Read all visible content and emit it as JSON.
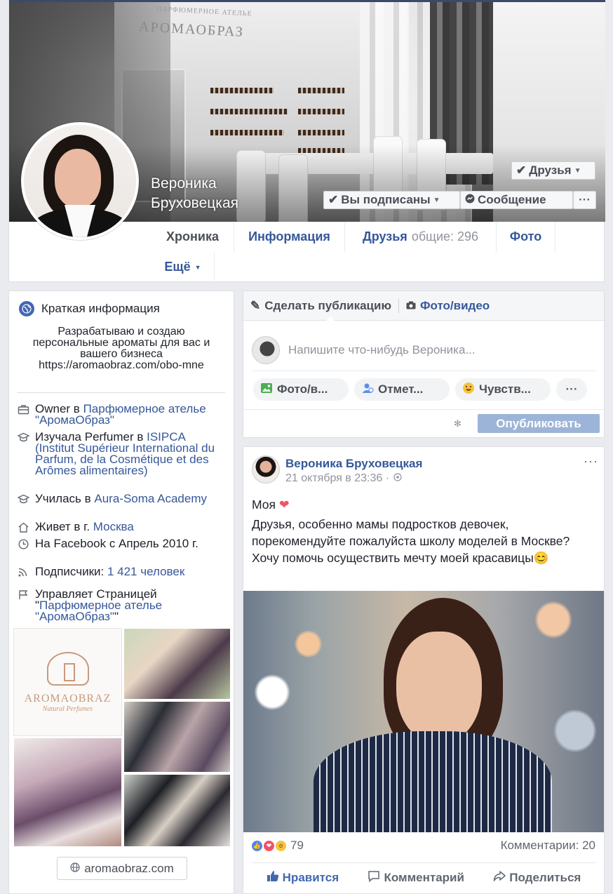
{
  "profile": {
    "name": "Вероника Бруховецкая",
    "cover_brand": "АРОМАОБРАЗ",
    "cover_brand_small": "ПАРФЮМЕРНОЕ АТЕЛЬЕ"
  },
  "buttons": {
    "friends": "Друзья",
    "subscribed": "Вы подписаны",
    "message": "Сообщение",
    "more": "···"
  },
  "tabs": {
    "timeline": "Хроника",
    "about": "Информация",
    "friends": "Друзья",
    "friends_mutual": "общие: 296",
    "photos": "Фото",
    "more": "Ещё"
  },
  "intro": {
    "title": "Краткая информация",
    "bio": "Разрабатываю и создаю персональные ароматы для вас и вашего бизнеса https://aromaobraz.com/obo-mne",
    "owner_prefix": "Owner в ",
    "owner_link": "Парфюмерное ателье \"АромаОбраз\"",
    "studied_prefix": "Изучала Perfumer в ",
    "studied_link": "ISIPCA (Institut Supérieur International du Parfum, de la Cosmétique et des Arômes alimentaires)",
    "studied2_prefix": "Училась в ",
    "studied2_link": "Aura-Soma Academy",
    "lives_prefix": "Живет в г. ",
    "lives_link": "Москва",
    "since": "На Facebook с Апрель 2010 г.",
    "followers_prefix": "Подписчики: ",
    "followers_link": "1 421 человек",
    "manages_prefix": "Управляет Страницей \"",
    "manages_link": "Парфюмерное ателье \"АромаОбраз\"",
    "manages_suffix": "\"",
    "logo_name": "AROMAOBRAZ",
    "logo_sub": "Natural Perfumes",
    "website": "aromaobraz.com"
  },
  "composer": {
    "tab_post": "Сделать публикацию",
    "tab_photo": "Фото/видео",
    "placeholder": "Напишите что-нибудь Вероника...",
    "pill_photo": "Фото/в...",
    "pill_tag": "Отмет...",
    "pill_feeling": "Чувств...",
    "pill_more": "···",
    "publish": "Опубликовать"
  },
  "post": {
    "author": "Вероника Бруховецкая",
    "time": "21 октября в 23:36 ·",
    "line1": "Моя",
    "body": "Друзья, особенно мамы подростков девочек, порекомендуйте пожалуйста школу моделей в Москве? Хочу помочь осуществить мечту моей красавицы😊",
    "reactions_count": "79",
    "comments": "Комментарии: 20",
    "like": "Нравится",
    "comment": "Комментарий",
    "share": "Поделиться",
    "dots": "···"
  }
}
